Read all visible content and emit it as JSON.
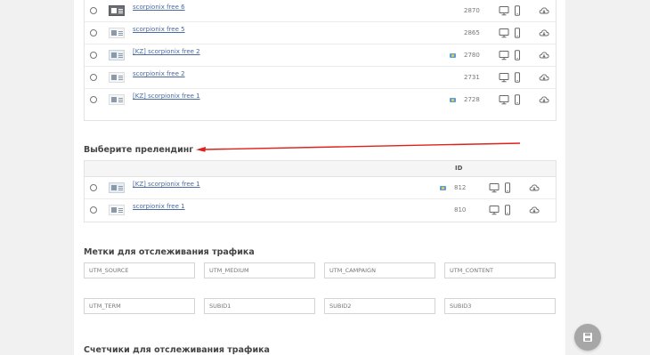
{
  "offers": [
    {
      "name": "scorpionix free 6",
      "count": "2870",
      "flag": false,
      "thumb": "dark"
    },
    {
      "name": "scorpionix free 5",
      "count": "2865",
      "flag": false,
      "thumb": "light"
    },
    {
      "name": "[KZ] scorpionix free 2",
      "count": "2780",
      "flag": true,
      "thumb": "blue"
    },
    {
      "name": "scorpionix free 2",
      "count": "2731",
      "flag": false,
      "thumb": "light"
    },
    {
      "name": "[KZ] scorpionix free 1",
      "count": "2728",
      "flag": true,
      "thumb": "light"
    }
  ],
  "prelanding": {
    "title": "Выберите прелендинг",
    "id_header": "ID",
    "rows": [
      {
        "name": "[KZ] scorpionix free 1",
        "id": "812",
        "flag": true,
        "thumb": "blue"
      },
      {
        "name": "scorpionix free 1",
        "id": "810",
        "flag": false,
        "thumb": "light"
      }
    ]
  },
  "tracking": {
    "title": "Метки для отслеживания трафика",
    "fields": [
      "UTM_SOURCE",
      "UTM_MEDIUM",
      "UTM_CAMPAIGN",
      "UTM_CONTENT",
      "UTM_TERM",
      "SUBID1",
      "SUBID2",
      "SUBID3"
    ]
  },
  "counters": {
    "title": "Счетчики для отслеживания трафика"
  },
  "icons": {
    "desktop": "desktop-icon",
    "mobile": "mobile-icon",
    "download": "cloud-download-icon",
    "fab": "save-icon",
    "arrow": "red-arrow-annotation"
  },
  "colors": {
    "link": "#4a6aa0",
    "arrow": "#e0201a",
    "fab": "#a7a7a7"
  }
}
